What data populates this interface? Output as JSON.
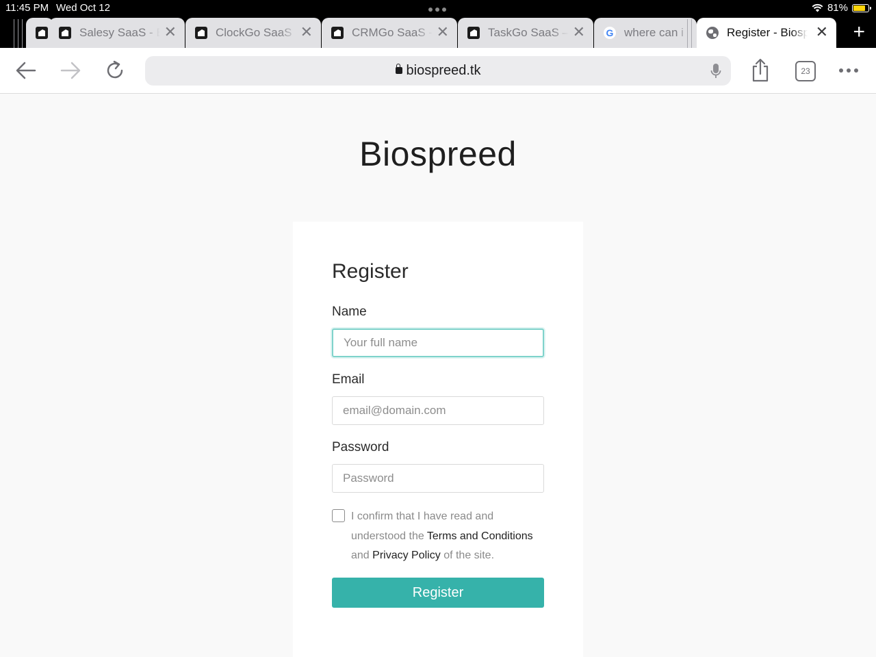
{
  "status_bar": {
    "time": "11:45 PM",
    "date": "Wed Oct 12",
    "battery_percent": "81%",
    "battery_level": 0.81,
    "battery_color": "#ffd60a"
  },
  "tabs": [
    {
      "title": "Salesy SaaS - B",
      "favicon": "app-logo-icon",
      "active": false
    },
    {
      "title": "ClockGo SaaS",
      "favicon": "app-logo-icon",
      "active": false
    },
    {
      "title": "CRMGo SaaS -",
      "favicon": "app-logo-icon",
      "active": false
    },
    {
      "title": "TaskGo SaaS –",
      "favicon": "app-logo-icon",
      "active": false
    },
    {
      "title": "where can i",
      "favicon": "google-icon",
      "active": false
    },
    {
      "title": "Register - Biospreed",
      "favicon": "globe-icon",
      "active": true
    }
  ],
  "toolbar": {
    "url": "biospreed.tk",
    "tab_count": "23"
  },
  "page": {
    "brand": "Biospreed",
    "form_title": "Register",
    "name_label": "Name",
    "name_placeholder": "Your full name",
    "email_label": "Email",
    "email_placeholder": "email@domain.com",
    "password_label": "Password",
    "password_placeholder": "Password",
    "consent_prefix": "I confirm that I have read and understood the",
    "terms_link": "Terms and Conditions",
    "consent_middle": "and",
    "privacy_link": "Privacy Policy",
    "consent_suffix": "of the site.",
    "submit_label": "Register",
    "accent_color": "#36b2aa"
  }
}
